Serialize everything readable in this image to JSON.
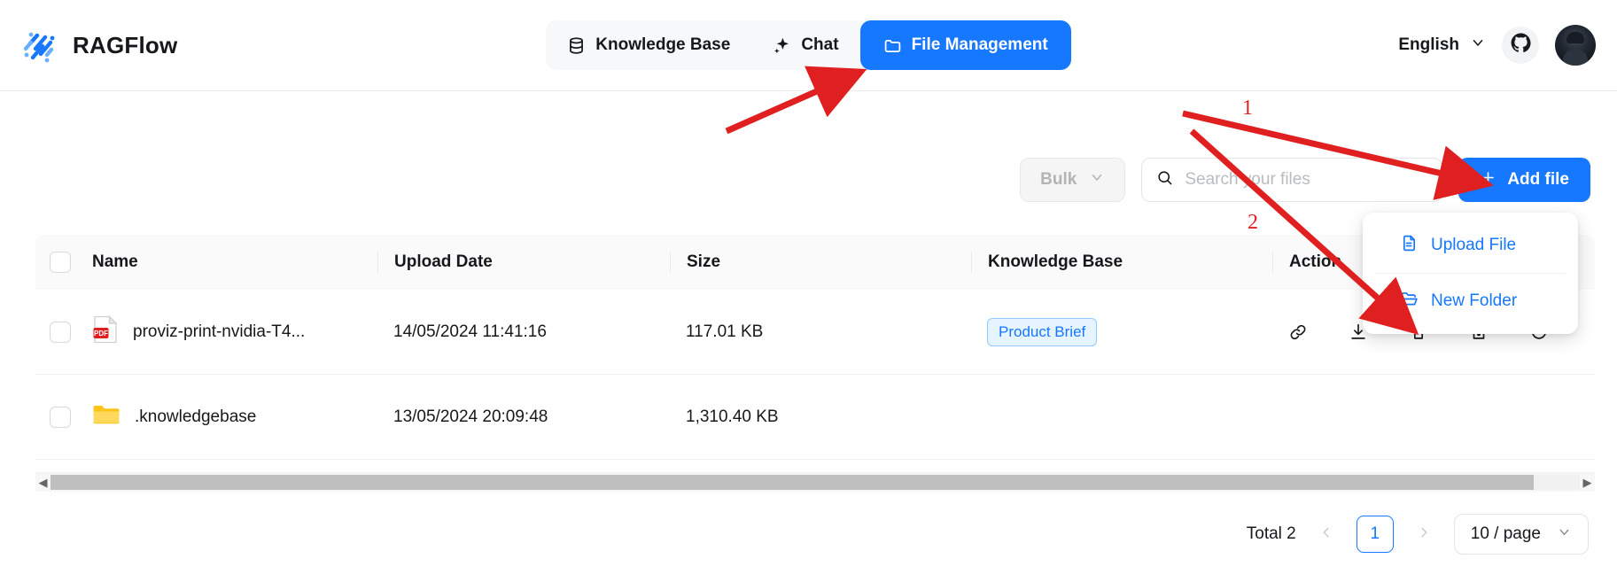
{
  "header": {
    "brand": "RAGFlow",
    "logo_icon": "ragflow-logo-icon",
    "nav": [
      {
        "label": "Knowledge Base",
        "icon": "database-icon",
        "active": false
      },
      {
        "label": "Chat",
        "icon": "sparkle-icon",
        "active": false
      },
      {
        "label": "File Management",
        "icon": "folder-icon",
        "active": true
      }
    ],
    "language": "English",
    "language_chevron_icon": "chevron-down-icon",
    "github_icon": "github-icon",
    "avatar": "user-avatar"
  },
  "toolbar": {
    "bulk_label": "Bulk",
    "bulk_chevron_icon": "chevron-down-icon",
    "search_placeholder": "Search your files",
    "search_value": "",
    "search_icon": "search-icon",
    "add_file_label": "Add file",
    "add_file_plus_icon": "plus-icon"
  },
  "dropdown": {
    "items": [
      {
        "label": "Upload File",
        "icon": "file-document-icon"
      },
      {
        "label": "New Folder",
        "icon": "folder-open-icon"
      }
    ]
  },
  "table": {
    "columns": [
      "Name",
      "Upload Date",
      "Size",
      "Knowledge Base",
      "Action"
    ],
    "rows": [
      {
        "name": "proviz-print-nvidia-T4...",
        "file_icon": "pdf-file-icon",
        "upload_date": "14/05/2024 11:41:16",
        "size": "117.01 KB",
        "knowledge_base": "Product Brief",
        "actions": [
          "link-icon",
          "download-icon",
          "delete-icon",
          "move-icon",
          "rename-icon"
        ]
      },
      {
        "name": ".knowledgebase",
        "file_icon": "folder-icon",
        "upload_date": "13/05/2024 20:09:48",
        "size": "1,310.40 KB",
        "knowledge_base": "",
        "actions": []
      }
    ]
  },
  "pagination": {
    "total_label": "Total 2",
    "prev_icon": "chevron-left-icon",
    "next_icon": "chevron-right-icon",
    "current_page": "1",
    "page_size": "10 / page",
    "page_size_chevron_icon": "chevron-down-icon"
  },
  "scrollbar": {
    "left_arrow_icon": "triangle-left-icon",
    "right_arrow_icon": "triangle-right-icon"
  },
  "annotations": [
    {
      "label": "1"
    },
    {
      "label": "2"
    }
  ],
  "colors": {
    "accent": "#1677ff",
    "annotation_red": "#e02020",
    "tag_bg": "#e6f4ff",
    "folder_yellow": "#fcc419"
  }
}
